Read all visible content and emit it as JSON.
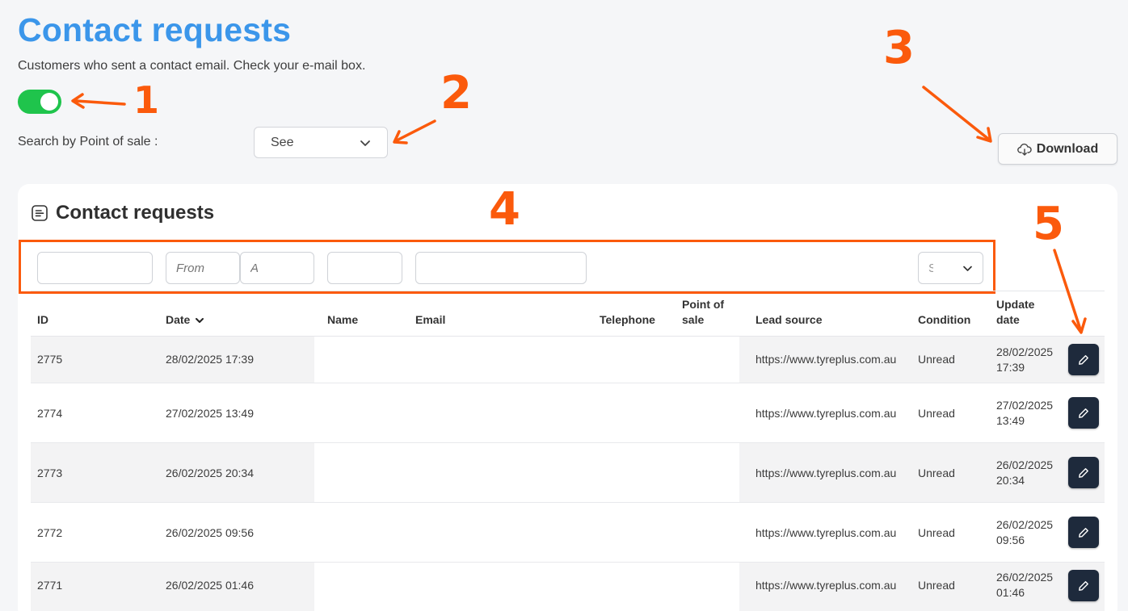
{
  "header": {
    "title": "Contact requests",
    "subtitle": "Customers who sent a contact email. Check your e-mail box.",
    "toggle_on": true,
    "search_label": "Search by Point of sale :",
    "pos_select_value": "See",
    "download_label": "Download"
  },
  "card": {
    "title": "Contact requests",
    "filters": {
      "date_from_placeholder": "From",
      "date_to_placeholder": "A",
      "select_value": "S"
    },
    "columns": {
      "id": "ID",
      "date": "Date",
      "name": "Name",
      "email": "Email",
      "telephone": "Telephone",
      "pos_line1": "Point of",
      "pos_line2": "sale",
      "lead_source": "Lead source",
      "condition": "Condition",
      "update_line1": "Update",
      "update_line2": "date"
    },
    "rows": [
      {
        "id": "2775",
        "date": "28/02/2025 17:39",
        "lead_source": "https://www.tyreplus.com.au",
        "condition": "Unread",
        "update_date": "28/02/2025",
        "update_time": "17:39"
      },
      {
        "id": "2774",
        "date": "27/02/2025 13:49",
        "lead_source": "https://www.tyreplus.com.au",
        "condition": "Unread",
        "update_date": "27/02/2025",
        "update_time": "13:49"
      },
      {
        "id": "2773",
        "date": "26/02/2025 20:34",
        "lead_source": "https://www.tyreplus.com.au",
        "condition": "Unread",
        "update_date": "26/02/2025",
        "update_time": "20:34"
      },
      {
        "id": "2772",
        "date": "26/02/2025 09:56",
        "lead_source": "https://www.tyreplus.com.au",
        "condition": "Unread",
        "update_date": "26/02/2025",
        "update_time": "09:56"
      },
      {
        "id": "2771",
        "date": "26/02/2025 01:46",
        "lead_source": "https://www.tyreplus.com.au",
        "condition": "Unread",
        "update_date": "26/02/2025",
        "update_time": "01:46"
      }
    ]
  },
  "annotations": [
    "1",
    "2",
    "3",
    "4",
    "5"
  ],
  "colors": {
    "title_blue": "#3b96ea",
    "toggle_green": "#1fc44c",
    "annotation_orange": "#fb5a0c",
    "edit_button": "#1e2a3c"
  },
  "icons": {
    "download": "cloud-download-icon",
    "card_title": "document-list-icon",
    "sort": "chevron-down-icon",
    "edit": "pencil-icon",
    "select": "chevron-down-icon"
  }
}
